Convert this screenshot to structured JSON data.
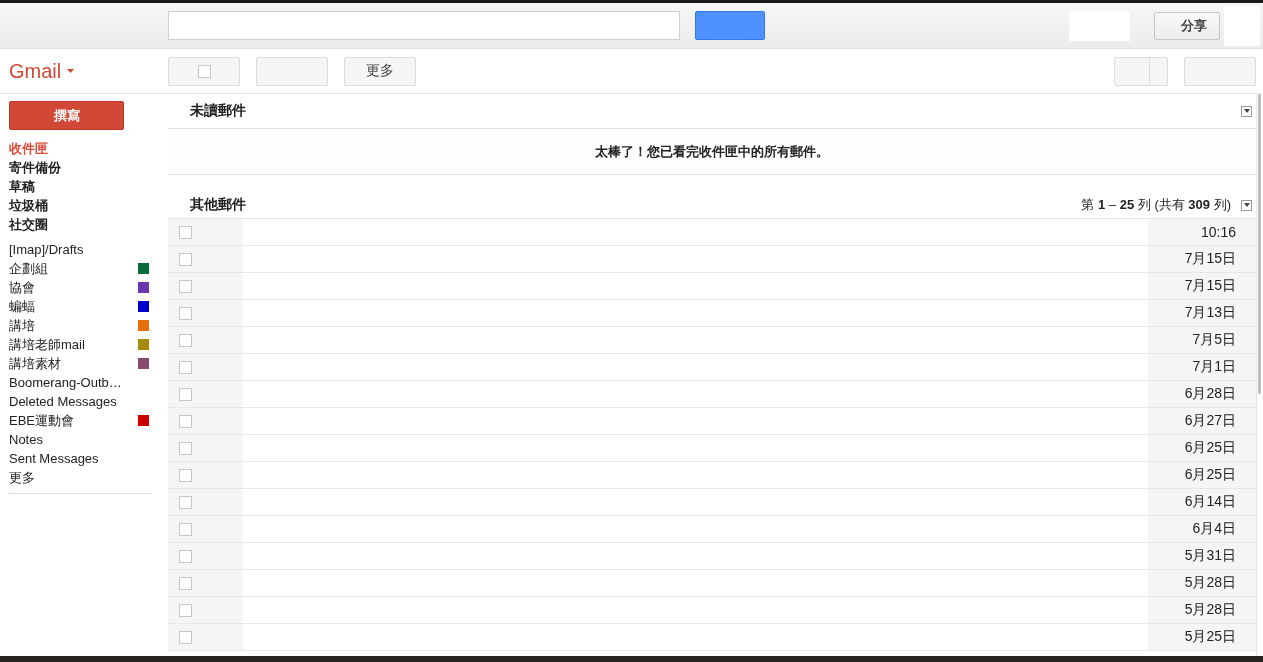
{
  "header": {
    "share_button": "分享"
  },
  "app_title": "Gmail",
  "toolbar": {
    "select_checked": false,
    "more_button": "更多"
  },
  "compose_button": "撰寫",
  "sidebar": {
    "items": [
      {
        "label": "收件匣",
        "selected": true
      },
      {
        "label": "寄件備份",
        "selected": false
      },
      {
        "label": "草稿",
        "selected": false
      },
      {
        "label": "垃圾桶",
        "selected": false
      },
      {
        "label": "社交圈",
        "selected": false
      }
    ],
    "labels": [
      {
        "label": "[Imap]/Drafts"
      },
      {
        "label": "企劃組",
        "color": "#0b6b3a"
      },
      {
        "label": "協會",
        "color": "#6a35b0"
      },
      {
        "label": "蝙蝠",
        "color": "#0000cc"
      },
      {
        "label": "講培",
        "color": "#e8700a"
      },
      {
        "label": "講培老師mail",
        "color": "#a88a0a"
      },
      {
        "label": "講培素材",
        "color": "#8a4a6a"
      },
      {
        "label": "Boomerang-Outb…"
      },
      {
        "label": "Deleted Messages"
      },
      {
        "label": "EBE運動會",
        "color": "#cc0000"
      },
      {
        "label": "Notes"
      },
      {
        "label": "Sent Messages"
      },
      {
        "label": "更多"
      }
    ]
  },
  "unread_section": {
    "title": "未讀郵件",
    "message": "太棒了！您已看完收件匣中的所有郵件。"
  },
  "other_section": {
    "title": "其他郵件",
    "pagination": "第 **1** – **25** 列 (共有 **309** 列)"
  },
  "messages": [
    {
      "date": "10:16",
      "checked": false
    },
    {
      "date": "7月15日",
      "checked": false
    },
    {
      "date": "7月15日",
      "checked": false
    },
    {
      "date": "7月13日",
      "checked": false
    },
    {
      "date": "7月5日",
      "checked": false
    },
    {
      "date": "7月1日",
      "checked": false
    },
    {
      "date": "6月28日",
      "checked": false
    },
    {
      "date": "6月27日",
      "checked": false
    },
    {
      "date": "6月25日",
      "checked": false
    },
    {
      "date": "6月25日",
      "checked": false
    },
    {
      "date": "6月14日",
      "checked": false
    },
    {
      "date": "6月4日",
      "checked": false
    },
    {
      "date": "5月31日",
      "checked": false
    },
    {
      "date": "5月28日",
      "checked": false
    },
    {
      "date": "5月28日",
      "checked": false
    },
    {
      "date": "5月25日",
      "checked": false
    }
  ]
}
